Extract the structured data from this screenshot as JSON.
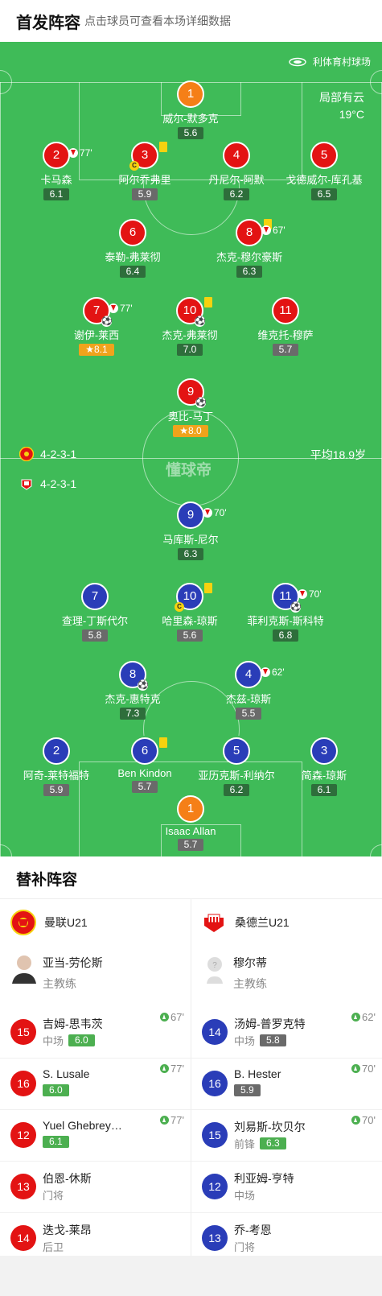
{
  "header": {
    "title": "首发阵容",
    "subtitle": "点击球员可查看本场详细数据"
  },
  "venue": {
    "name": "利体育村球场",
    "icon": "stadium-icon"
  },
  "weather": {
    "condition": "局部有云",
    "temp": "19°C"
  },
  "home": {
    "formation": "4-2-3-1",
    "players": [
      {
        "num": "1",
        "name": "威尔-默多克",
        "rating": "5.6",
        "rt": "dg"
      },
      {
        "num": "2",
        "name": "卡马森",
        "rating": "6.1",
        "rt": "dg",
        "sub_min": "77'"
      },
      {
        "num": "3",
        "name": "阿尔乔弗里",
        "rating": "5.9",
        "rt": "gr",
        "captain": "C"
      },
      {
        "num": "4",
        "name": "丹尼尔-阿默",
        "rating": "6.2",
        "rt": "dg"
      },
      {
        "num": "5",
        "name": "戈德威尔-库孔基",
        "rating": "6.5",
        "rt": "dg"
      },
      {
        "num": "6",
        "name": "泰勒-弗莱彻",
        "rating": "6.4",
        "rt": "dg"
      },
      {
        "num": "8",
        "name": "杰克-穆尔豪斯",
        "rating": "6.3",
        "rt": "dg",
        "sub_min": "67'"
      },
      {
        "num": "7",
        "name": "谢伊-莱西",
        "rating": "8.1",
        "rt": "or",
        "sub_min": "77'"
      },
      {
        "num": "10",
        "name": "杰克-弗莱彻",
        "rating": "7.0",
        "rt": "dg"
      },
      {
        "num": "11",
        "name": "维克托-穆萨",
        "rating": "5.7",
        "rt": "gr"
      },
      {
        "num": "9",
        "name": "奥比-马丁",
        "rating": "8.0",
        "rt": "or"
      }
    ]
  },
  "away": {
    "formation": "4-2-3-1",
    "avg_age": "平均18.9岁",
    "players": [
      {
        "num": "9",
        "name": "马库斯-尼尔",
        "rating": "6.3",
        "rt": "dg",
        "sub_min": "70'"
      },
      {
        "num": "7",
        "name": "查理-丁斯代尔",
        "rating": "5.8",
        "rt": "gr"
      },
      {
        "num": "10",
        "name": "哈里森-琼斯",
        "rating": "5.6",
        "rt": "gr",
        "captain": "C"
      },
      {
        "num": "11",
        "name": "菲利克斯-斯科特",
        "rating": "6.8",
        "rt": "dg",
        "sub_min": "70'"
      },
      {
        "num": "8",
        "name": "杰克-惠特克",
        "rating": "7.3",
        "rt": "dg"
      },
      {
        "num": "4",
        "name": "杰兹-琼斯",
        "rating": "5.5",
        "rt": "gr",
        "sub_min": "62'"
      },
      {
        "num": "2",
        "name": "阿奇-莱特福特",
        "rating": "5.9",
        "rt": "gr"
      },
      {
        "num": "6",
        "name": "Ben Kindon",
        "rating": "5.7",
        "rt": "gr"
      },
      {
        "num": "5",
        "name": "亚历克斯-利纳尔",
        "rating": "6.2",
        "rt": "dg"
      },
      {
        "num": "3",
        "name": "简森-琼斯",
        "rating": "6.1",
        "rt": "dg"
      },
      {
        "num": "1",
        "name": "Isaac Allan",
        "rating": "5.7",
        "rt": "gr"
      }
    ]
  },
  "watermark": "懂球帝",
  "subs": {
    "title": "替补阵容",
    "home_team": "曼联U21",
    "away_team": "桑德兰U21",
    "home_coach": {
      "name": "亚当-劳伦斯",
      "role": "主教练"
    },
    "away_coach": {
      "name": "穆尔蒂",
      "role": "主教练"
    },
    "home": [
      {
        "num": "15",
        "name": "吉姆-思韦茨",
        "pos": "中场",
        "rating": "6.0",
        "min": "67'"
      },
      {
        "num": "16",
        "name": "S. Lusale",
        "pos": "",
        "rating": "6.0",
        "min": "77'"
      },
      {
        "num": "12",
        "name": "Yuel Ghebrey…",
        "pos": "",
        "rating": "6.1",
        "min": "77'"
      },
      {
        "num": "13",
        "name": "伯恩-休斯",
        "pos": "门将",
        "rating": "",
        "min": ""
      },
      {
        "num": "14",
        "name": "迭戈-莱昂",
        "pos": "后卫",
        "rating": "",
        "min": ""
      }
    ],
    "away": [
      {
        "num": "14",
        "name": "汤姆-普罗克特",
        "pos": "中场",
        "rating": "5.8",
        "rgray": true,
        "min": "62'"
      },
      {
        "num": "16",
        "name": "B. Hester",
        "pos": "",
        "rating": "5.9",
        "rgray": true,
        "min": "70'"
      },
      {
        "num": "15",
        "name": "刘易斯-坎贝尔",
        "pos": "前锋",
        "rating": "6.3",
        "rgray": false,
        "min": "70'"
      },
      {
        "num": "12",
        "name": "利亚姆-亨特",
        "pos": "中场",
        "rating": "",
        "min": ""
      },
      {
        "num": "13",
        "name": "乔-考恩",
        "pos": "门将",
        "rating": "",
        "min": ""
      }
    ]
  }
}
